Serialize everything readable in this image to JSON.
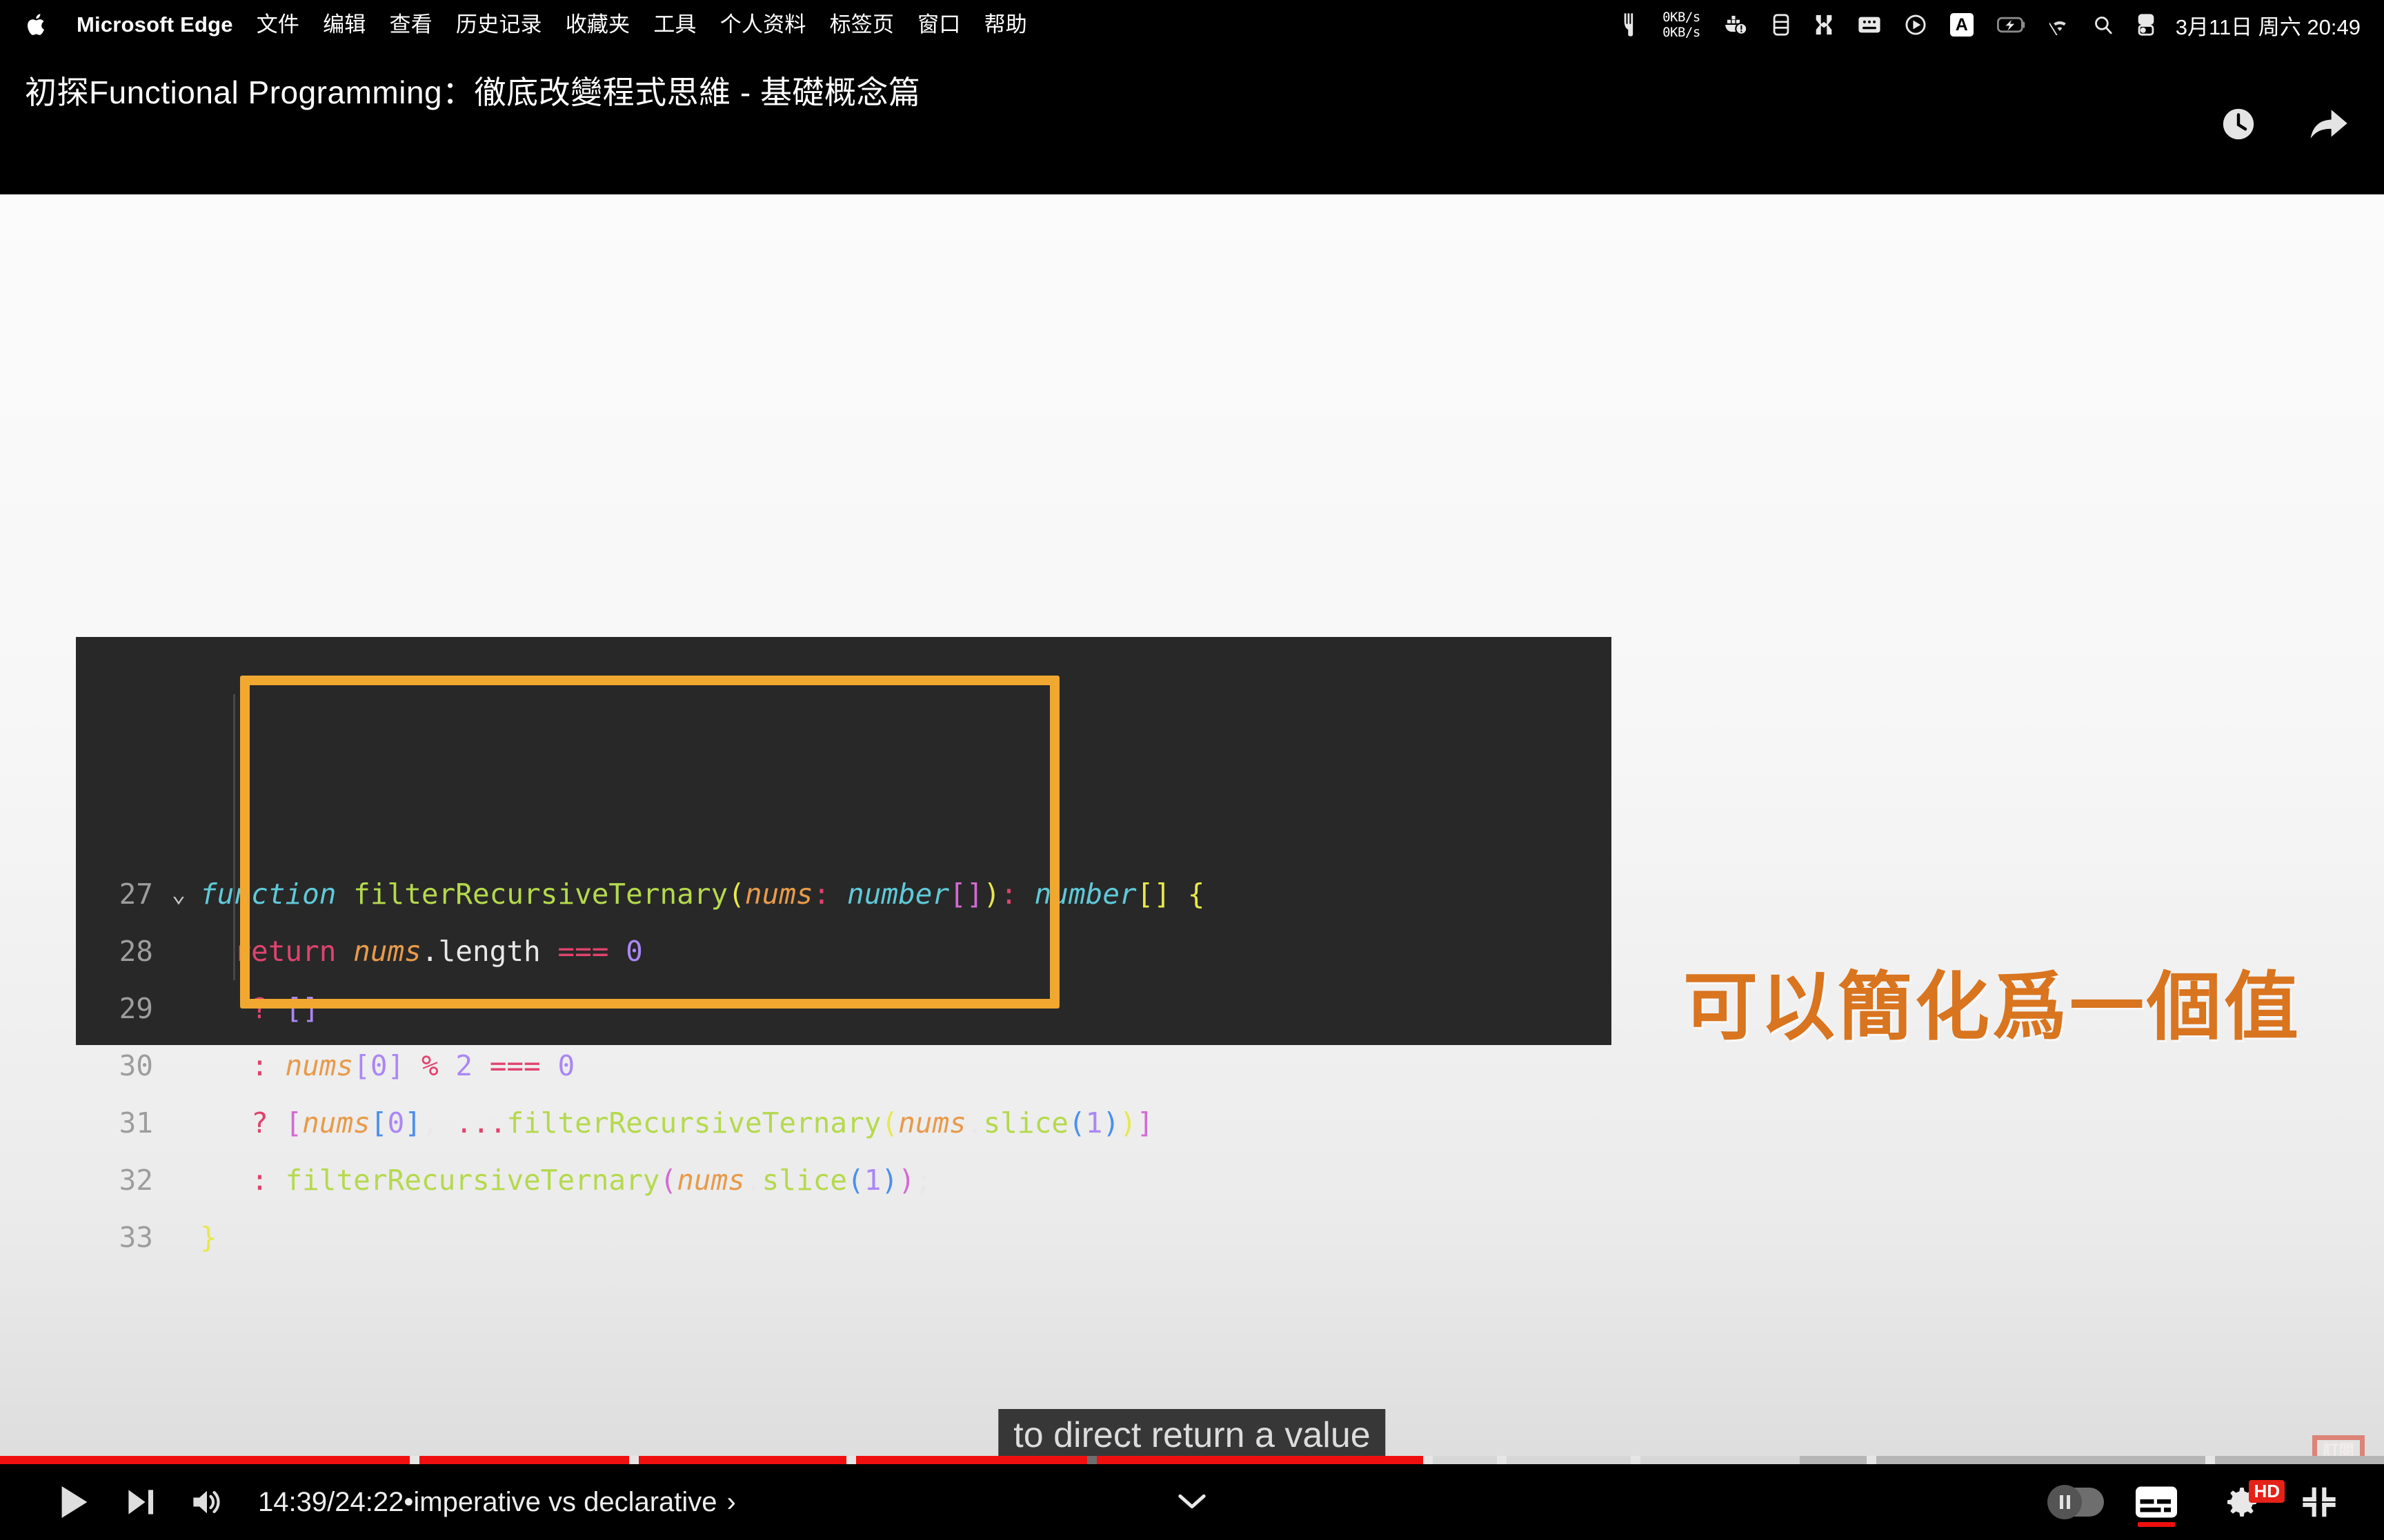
{
  "menubar": {
    "apple_icon": "apple-logo-icon",
    "app_name": "Microsoft Edge",
    "items": [
      "文件",
      "编辑",
      "查看",
      "历史记录",
      "收藏夹",
      "工具",
      "个人资料",
      "标签页",
      "窗口",
      "帮助"
    ],
    "status": {
      "net_up": "0KB/s",
      "net_down": "0KB/s",
      "input_source": "A",
      "clock": "3月11日 周六 20:49",
      "icons": [
        "cat-monitor-icon",
        "network-speed-icon",
        "docker-alert-icon",
        "battery-detail-icon",
        "shortcuts-icon",
        "keyboard-icon",
        "playback-icon",
        "input-source-icon",
        "battery-charging-icon",
        "wifi-off-icon",
        "spotlight-search-icon",
        "control-center-icon"
      ]
    }
  },
  "player": {
    "title": "初探Functional Programming：徹底改變程式思維 - 基礎概念篇",
    "top_actions": [
      {
        "name": "watch-later-button",
        "icon": "clock-icon"
      },
      {
        "name": "share-button",
        "icon": "share-arrow-icon"
      }
    ],
    "controls": {
      "play_icon": "play-triangle-icon",
      "next_icon": "next-track-icon",
      "volume_icon": "volume-on-icon",
      "time_current": "14:39",
      "time_separator": " / ",
      "time_total": "24:22",
      "chapter_separator": " • ",
      "chapter_title": "imperative vs declarative",
      "chapter_chevron": "›",
      "center_chevron_icon": "chevron-down-icon",
      "autoplay_icon": "autoplay-pause-toggle-icon",
      "subtitles_icon": "closed-captions-icon",
      "settings_icon": "gear-icon",
      "quality_badge": "HD",
      "fullscreen_icon": "exit-fullscreen-icon"
    },
    "progress": {
      "played_fraction": 0.598,
      "loaded_fraction": 0.755,
      "chapters": [
        {
          "start": 0.0,
          "end": 0.172
        },
        {
          "start": 0.176,
          "end": 0.264
        },
        {
          "start": 0.268,
          "end": 0.355
        },
        {
          "start": 0.359,
          "end": 0.456
        },
        {
          "start": 0.46,
          "end": 0.597
        },
        {
          "start": 0.601,
          "end": 0.628
        },
        {
          "start": 0.632,
          "end": 0.684
        },
        {
          "start": 0.688,
          "end": 0.783
        },
        {
          "start": 0.787,
          "end": 0.925
        },
        {
          "start": 0.929,
          "end": 1.0
        }
      ]
    },
    "subtitle": "to direct return a value",
    "watermark": {
      "line1": "訂閱",
      "line2": "頻道"
    }
  },
  "slide": {
    "annotation": "可以簡化爲一個值",
    "annotation_color": "#d9741f",
    "code": {
      "lines": [
        {
          "no": "27",
          "fold": "⌄",
          "tokens": [
            {
              "t": "function",
              "c": "t-key"
            },
            {
              "t": " ",
              "c": "t-plain"
            },
            {
              "t": "filterRecursiveTernary",
              "c": "t-fn"
            },
            {
              "t": "(",
              "c": "t-p-yellow"
            },
            {
              "t": "nums",
              "c": "t-param"
            },
            {
              "t": ":",
              "c": "t-colon"
            },
            {
              "t": " ",
              "c": "t-plain"
            },
            {
              "t": "number",
              "c": "t-key"
            },
            {
              "t": "[]",
              "c": "t-p-pink"
            },
            {
              "t": ")",
              "c": "t-p-yellow"
            },
            {
              "t": ":",
              "c": "t-colon"
            },
            {
              "t": " ",
              "c": "t-plain"
            },
            {
              "t": "number",
              "c": "t-key"
            },
            {
              "t": "[]",
              "c": "t-p-yellow"
            },
            {
              "t": " ",
              "c": "t-plain"
            },
            {
              "t": "{",
              "c": "t-p-yellow"
            }
          ]
        },
        {
          "no": "28",
          "fold": "",
          "indent": 2,
          "tokens": [
            {
              "t": "return",
              "c": "t-ret"
            },
            {
              "t": " ",
              "c": "t-plain"
            },
            {
              "t": "nums",
              "c": "t-param"
            },
            {
              "t": ".",
              "c": "t-plain"
            },
            {
              "t": "length",
              "c": "t-plain"
            },
            {
              "t": " ",
              "c": "t-plain"
            },
            {
              "t": "===",
              "c": "t-ret"
            },
            {
              "t": " ",
              "c": "t-plain"
            },
            {
              "t": "0",
              "c": "t-num"
            }
          ]
        },
        {
          "no": "29",
          "fold": "",
          "indent": 3,
          "tokens": [
            {
              "t": "?",
              "c": "t-ret"
            },
            {
              "t": " ",
              "c": "t-plain"
            },
            {
              "t": "[]",
              "c": "t-p-purple"
            }
          ]
        },
        {
          "no": "30",
          "fold": "",
          "indent": 3,
          "tokens": [
            {
              "t": ":",
              "c": "t-ret"
            },
            {
              "t": " ",
              "c": "t-plain"
            },
            {
              "t": "nums",
              "c": "t-param"
            },
            {
              "t": "[",
              "c": "t-p-purple"
            },
            {
              "t": "0",
              "c": "t-num"
            },
            {
              "t": "]",
              "c": "t-p-purple"
            },
            {
              "t": " ",
              "c": "t-plain"
            },
            {
              "t": "%",
              "c": "t-ret"
            },
            {
              "t": " ",
              "c": "t-plain"
            },
            {
              "t": "2",
              "c": "t-num"
            },
            {
              "t": " ",
              "c": "t-plain"
            },
            {
              "t": "===",
              "c": "t-ret"
            },
            {
              "t": " ",
              "c": "t-plain"
            },
            {
              "t": "0",
              "c": "t-num"
            }
          ]
        },
        {
          "no": "31",
          "fold": "",
          "indent": 3,
          "tokens": [
            {
              "t": "?",
              "c": "t-ret"
            },
            {
              "t": " ",
              "c": "t-plain"
            },
            {
              "t": "[",
              "c": "t-p-pink"
            },
            {
              "t": "nums",
              "c": "t-param"
            },
            {
              "t": "[",
              "c": "t-p-blue"
            },
            {
              "t": "0",
              "c": "t-num"
            },
            {
              "t": "]",
              "c": "t-p-blue"
            },
            {
              "t": ",",
              "c": "t-plain"
            },
            {
              "t": " ",
              "c": "t-plain"
            },
            {
              "t": "...",
              "c": "t-ret"
            },
            {
              "t": "filterRecursiveTernary",
              "c": "t-fn"
            },
            {
              "t": "(",
              "c": "t-p-yellow"
            },
            {
              "t": "nums",
              "c": "t-param"
            },
            {
              "t": ".",
              "c": "t-plain"
            },
            {
              "t": "slice",
              "c": "t-fn"
            },
            {
              "t": "(",
              "c": "t-p-blue"
            },
            {
              "t": "1",
              "c": "t-num"
            },
            {
              "t": ")",
              "c": "t-p-blue"
            },
            {
              "t": ")",
              "c": "t-p-yellow"
            },
            {
              "t": "]",
              "c": "t-p-pink"
            }
          ]
        },
        {
          "no": "32",
          "fold": "",
          "indent": 3,
          "tokens": [
            {
              "t": ":",
              "c": "t-ret"
            },
            {
              "t": " ",
              "c": "t-plain"
            },
            {
              "t": "filterRecursiveTernary",
              "c": "t-fn"
            },
            {
              "t": "(",
              "c": "t-p-pink"
            },
            {
              "t": "nums",
              "c": "t-param"
            },
            {
              "t": ".",
              "c": "t-plain"
            },
            {
              "t": "slice",
              "c": "t-fn"
            },
            {
              "t": "(",
              "c": "t-p-blue"
            },
            {
              "t": "1",
              "c": "t-num"
            },
            {
              "t": ")",
              "c": "t-p-blue"
            },
            {
              "t": ")",
              "c": "t-p-pink"
            },
            {
              "t": ";",
              "c": "t-plain"
            }
          ]
        },
        {
          "no": "33",
          "fold": "",
          "indent": 0,
          "tokens": [
            {
              "t": "}",
              "c": "t-p-yellow"
            }
          ]
        }
      ]
    }
  }
}
